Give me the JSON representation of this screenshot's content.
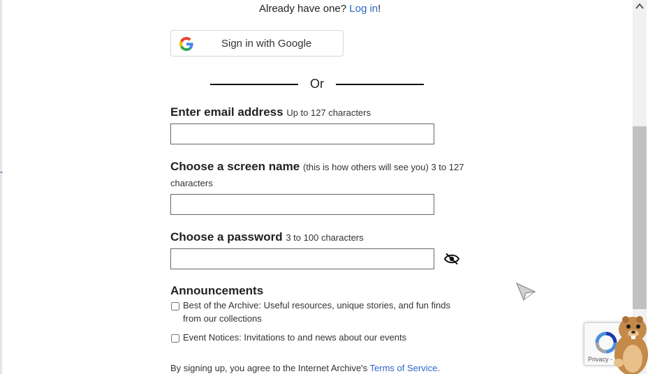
{
  "header": {
    "already_text": "Already have one?",
    "login_link": "Log in",
    "login_suffix": "!"
  },
  "google_signin": {
    "label": "Sign in with Google",
    "icon": "google-g-icon"
  },
  "divider": {
    "text": "Or"
  },
  "form": {
    "email": {
      "label": "Enter email address",
      "hint": "Up to 127 characters",
      "value": "",
      "placeholder": ""
    },
    "screen_name": {
      "label": "Choose a screen name",
      "hint_line1": "(this is how others will see you) 3 to 127",
      "hint_line2": "characters",
      "value": "",
      "placeholder": ""
    },
    "password": {
      "label": "Choose a password",
      "hint": "3 to 100 characters",
      "value": "",
      "placeholder": "",
      "toggle_icon": "eye-hidden-icon"
    }
  },
  "announcements": {
    "title": "Announcements",
    "items": [
      {
        "line1": "Best of the Archive: Useful resources, unique stories, and fun finds",
        "line2": "from our collections",
        "checked": false
      },
      {
        "line1": "Event Notices: Invitations to and news about our events",
        "checked": false
      }
    ]
  },
  "terms": {
    "prefix": "By signing up, you agree to the Internet Archive's",
    "link": "Terms of Service",
    "suffix": "."
  },
  "recaptcha": {
    "text": "Privacy - Te"
  },
  "colors": {
    "link": "#2c66c8",
    "text": "#222222",
    "scrollbar_thumb": "#c1c1c1"
  }
}
